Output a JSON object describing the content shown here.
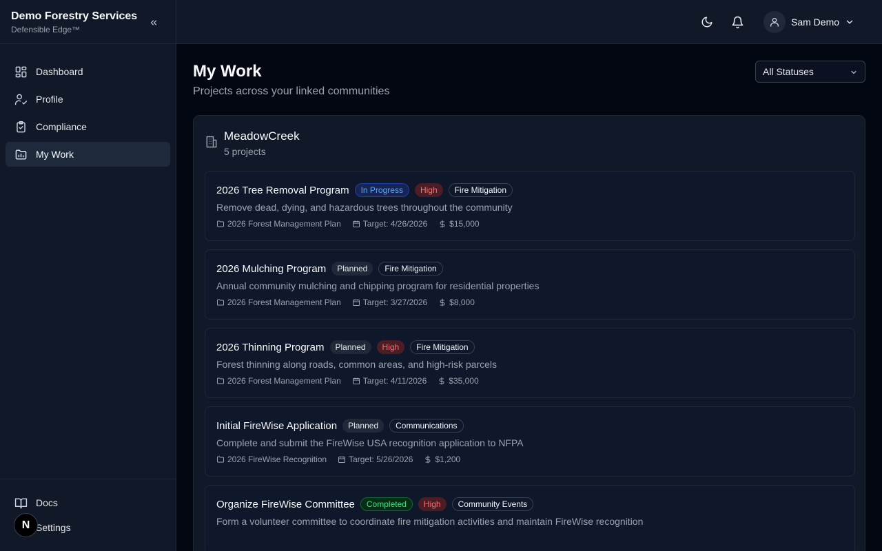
{
  "brand": {
    "title": "Demo Forestry Services",
    "subtitle": "Defensible Edge™"
  },
  "nav": {
    "items": [
      {
        "label": "Dashboard",
        "icon": "dashboard-icon"
      },
      {
        "label": "Profile",
        "icon": "user-check-icon"
      },
      {
        "label": "Compliance",
        "icon": "clipboard-check-icon"
      },
      {
        "label": "My Work",
        "icon": "folder-chart-icon",
        "active": true
      }
    ],
    "bottom": [
      {
        "label": "Docs",
        "icon": "book-icon"
      },
      {
        "label": "Settings",
        "icon": "gear-icon"
      }
    ],
    "badge_letter": "N"
  },
  "header": {
    "user_name": "Sam Demo"
  },
  "page": {
    "title": "My Work",
    "subtitle": "Projects across your linked communities",
    "status_filter": "All Statuses"
  },
  "group": {
    "name": "MeadowCreek",
    "count": "5 projects",
    "projects": [
      {
        "title": "2026 Tree Removal Program",
        "status": "In Progress",
        "priority": "High",
        "category": "Fire Mitigation",
        "description": "Remove dead, dying, and hazardous trees throughout the community",
        "plan": "2026 Forest Management Plan",
        "target": "Target: 4/26/2026",
        "budget": "$15,000"
      },
      {
        "title": "2026 Mulching Program",
        "status": "Planned",
        "priority": "",
        "category": "Fire Mitigation",
        "description": "Annual community mulching and chipping program for residential properties",
        "plan": "2026 Forest Management Plan",
        "target": "Target: 3/27/2026",
        "budget": "$8,000"
      },
      {
        "title": "2026 Thinning Program",
        "status": "Planned",
        "priority": "High",
        "category": "Fire Mitigation",
        "description": "Forest thinning along roads, common areas, and high-risk parcels",
        "plan": "2026 Forest Management Plan",
        "target": "Target: 4/11/2026",
        "budget": "$35,000"
      },
      {
        "title": "Initial FireWise Application",
        "status": "Planned",
        "priority": "",
        "category": "Communications",
        "description": "Complete and submit the FireWise USA recognition application to NFPA",
        "plan": "2026 FireWise Recognition",
        "target": "Target: 5/26/2026",
        "budget": "$1,200"
      },
      {
        "title": "Organize FireWise Committee",
        "status": "Completed",
        "priority": "High",
        "category": "Community Events",
        "description": "Form a volunteer committee to coordinate fire mitigation activities and maintain FireWise recognition",
        "plan": "",
        "target": "",
        "budget": ""
      }
    ]
  }
}
